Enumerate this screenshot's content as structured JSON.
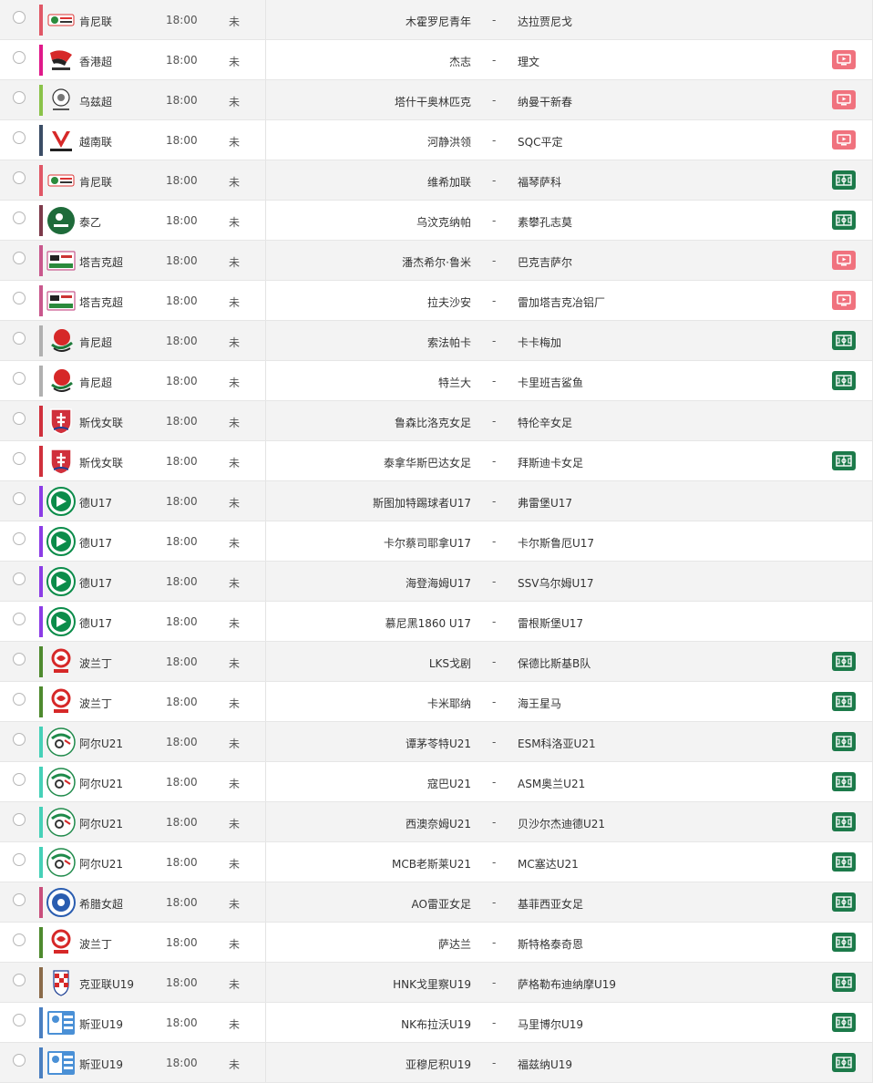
{
  "colors": {
    "tv_button": "#f0727e",
    "pitch_button": "#1c7a4a",
    "row_alt": "#f3f3f3"
  },
  "matches": [
    {
      "league": "肯尼联",
      "league_color": "#e05766",
      "logo": "kenya-federation-logo",
      "time": "18:00",
      "status": "未",
      "home": "木霍罗尼青年",
      "dash": "-",
      "away": "达拉贾尼戈",
      "broadcast": "none"
    },
    {
      "league": "香港超",
      "league_color": "#e0198a",
      "logo": "hong-kong-premier-league-logo",
      "time": "18:00",
      "status": "未",
      "home": "杰志",
      "dash": "-",
      "away": "理文",
      "broadcast": "tv"
    },
    {
      "league": "乌兹超",
      "league_color": "#8bc34a",
      "logo": "uzbekistan-league-logo",
      "time": "18:00",
      "status": "未",
      "home": "塔什干奥林匹克",
      "dash": "-",
      "away": "纳曼干新春",
      "broadcast": "tv"
    },
    {
      "league": "越南联",
      "league_color": "#3b4d66",
      "logo": "v-league-logo",
      "time": "18:00",
      "status": "未",
      "home": "河静洪领",
      "dash": "-",
      "away": "SQC平定",
      "broadcast": "tv"
    },
    {
      "league": "肯尼联",
      "league_color": "#e05766",
      "logo": "kenya-federation-logo",
      "time": "18:00",
      "status": "未",
      "home": "维希加联",
      "dash": "-",
      "away": "福琴萨科",
      "broadcast": "pitch"
    },
    {
      "league": "泰乙",
      "league_color": "#7d3a4a",
      "logo": "thai-league-logo",
      "time": "18:00",
      "status": "未",
      "home": "乌汶克纳帕",
      "dash": "-",
      "away": "素攀孔志莫",
      "broadcast": "pitch"
    },
    {
      "league": "塔吉克超",
      "league_color": "#c9588d",
      "logo": "tajikistan-league-logo",
      "time": "18:00",
      "status": "未",
      "home": "潘杰希尔·鲁米",
      "dash": "-",
      "away": "巴克吉萨尔",
      "broadcast": "tv"
    },
    {
      "league": "塔吉克超",
      "league_color": "#c9588d",
      "logo": "tajikistan-league-logo",
      "time": "18:00",
      "status": "未",
      "home": "拉夫沙安",
      "dash": "-",
      "away": "雷加塔吉克冶铝厂",
      "broadcast": "tv"
    },
    {
      "league": "肯尼超",
      "league_color": "#b0b0b0",
      "logo": "kenya-premier-league-logo",
      "time": "18:00",
      "status": "未",
      "home": "索法帕卡",
      "dash": "-",
      "away": "卡卡梅加",
      "broadcast": "pitch"
    },
    {
      "league": "肯尼超",
      "league_color": "#b0b0b0",
      "logo": "kenya-premier-league-logo",
      "time": "18:00",
      "status": "未",
      "home": "特兰大",
      "dash": "-",
      "away": "卡里班吉鲨鱼",
      "broadcast": "pitch"
    },
    {
      "league": "斯伐女联",
      "league_color": "#d0303c",
      "logo": "slovakia-crest-logo",
      "time": "18:00",
      "status": "未",
      "home": "鲁森比洛克女足",
      "dash": "-",
      "away": "特伦辛女足",
      "broadcast": "none"
    },
    {
      "league": "斯伐女联",
      "league_color": "#d0303c",
      "logo": "slovakia-crest-logo",
      "time": "18:00",
      "status": "未",
      "home": "泰拿华斯巴达女足",
      "dash": "-",
      "away": "拜斯迪卡女足",
      "broadcast": "pitch"
    },
    {
      "league": "德U17",
      "league_color": "#8c3ce6",
      "logo": "dfb-logo",
      "time": "18:00",
      "status": "未",
      "home": "斯图加特踢球者U17",
      "dash": "-",
      "away": "弗雷堡U17",
      "broadcast": "none"
    },
    {
      "league": "德U17",
      "league_color": "#8c3ce6",
      "logo": "dfb-logo",
      "time": "18:00",
      "status": "未",
      "home": "卡尔蔡司耶拿U17",
      "dash": "-",
      "away": "卡尔斯鲁厄U17",
      "broadcast": "none"
    },
    {
      "league": "德U17",
      "league_color": "#8c3ce6",
      "logo": "dfb-logo",
      "time": "18:00",
      "status": "未",
      "home": "海登海姆U17",
      "dash": "-",
      "away": "SSV乌尔姆U17",
      "broadcast": "none"
    },
    {
      "league": "德U17",
      "league_color": "#8c3ce6",
      "logo": "dfb-logo",
      "time": "18:00",
      "status": "未",
      "home": "慕尼黑1860 U17",
      "dash": "-",
      "away": "雷根斯堡U17",
      "broadcast": "none"
    },
    {
      "league": "波兰丁",
      "league_color": "#4e8a2e",
      "logo": "pzpn-logo",
      "time": "18:00",
      "status": "未",
      "home": "LKS戈剧",
      "dash": "-",
      "away": "保德比斯基B队",
      "broadcast": "pitch"
    },
    {
      "league": "波兰丁",
      "league_color": "#4e8a2e",
      "logo": "pzpn-logo",
      "time": "18:00",
      "status": "未",
      "home": "卡米耶纳",
      "dash": "-",
      "away": "海王星马",
      "broadcast": "pitch"
    },
    {
      "league": "阿尔U21",
      "league_color": "#46d1b8",
      "logo": "algeria-federation-logo",
      "time": "18:00",
      "status": "未",
      "home": "谭茅苓特U21",
      "dash": "-",
      "away": "ESM科洛亚U21",
      "broadcast": "pitch"
    },
    {
      "league": "阿尔U21",
      "league_color": "#46d1b8",
      "logo": "algeria-federation-logo",
      "time": "18:00",
      "status": "未",
      "home": "寇巴U21",
      "dash": "-",
      "away": "ASM奥兰U21",
      "broadcast": "pitch"
    },
    {
      "league": "阿尔U21",
      "league_color": "#46d1b8",
      "logo": "algeria-federation-logo",
      "time": "18:00",
      "status": "未",
      "home": "西澳奈姆U21",
      "dash": "-",
      "away": "贝沙尔杰迪德U21",
      "broadcast": "pitch"
    },
    {
      "league": "阿尔U21",
      "league_color": "#46d1b8",
      "logo": "algeria-federation-logo",
      "time": "18:00",
      "status": "未",
      "home": "MCB老斯莱U21",
      "dash": "-",
      "away": "MC塞达U21",
      "broadcast": "pitch"
    },
    {
      "league": "希腊女超",
      "league_color": "#c94f7c",
      "logo": "greek-federation-logo",
      "time": "18:00",
      "status": "未",
      "home": "AO雷亚女足",
      "dash": "-",
      "away": "基菲西亚女足",
      "broadcast": "pitch"
    },
    {
      "league": "波兰丁",
      "league_color": "#4e8a2e",
      "logo": "pzpn-logo",
      "time": "18:00",
      "status": "未",
      "home": "萨达兰",
      "dash": "-",
      "away": "斯特格泰奇恩",
      "broadcast": "pitch"
    },
    {
      "league": "克亚联U19",
      "league_color": "#8b6b4a",
      "logo": "croatia-federation-logo",
      "time": "18:00",
      "status": "未",
      "home": "HNK戈里察U19",
      "dash": "-",
      "away": "萨格勒布迪纳摩U19",
      "broadcast": "pitch"
    },
    {
      "league": "斯亚U19",
      "league_color": "#4a7fc0",
      "logo": "sml-logo",
      "time": "18:00",
      "status": "未",
      "home": "NK布拉沃U19",
      "dash": "-",
      "away": "马里博尔U19",
      "broadcast": "pitch"
    },
    {
      "league": "斯亚U19",
      "league_color": "#4a7fc0",
      "logo": "sml-logo",
      "time": "18:00",
      "status": "未",
      "home": "亚穆尼积U19",
      "dash": "-",
      "away": "福兹纳U19",
      "broadcast": "pitch"
    }
  ]
}
